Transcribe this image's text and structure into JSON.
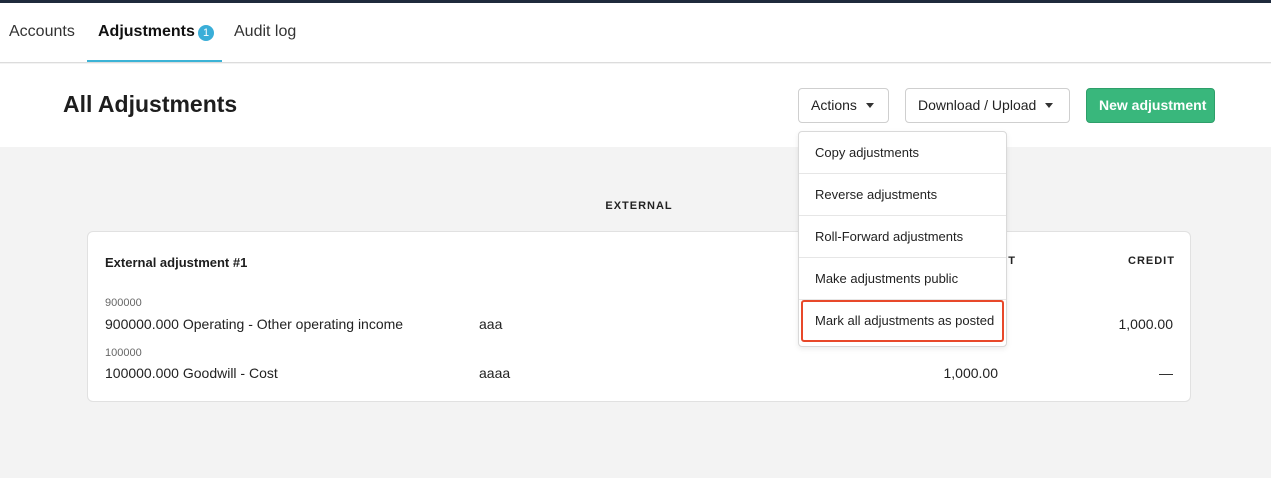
{
  "tabs": {
    "accounts": "Accounts",
    "adjustments": "Adjustments",
    "adjustments_badge": "1",
    "audit_log": "Audit log"
  },
  "header": {
    "title": "All Adjustments",
    "actions_label": "Actions",
    "download_upload_label": "Download / Upload",
    "new_adjustment_label": "New adjustment"
  },
  "section": {
    "label": "EXTERNAL"
  },
  "card": {
    "title": "External adjustment #1",
    "debit_header": "DEBIT",
    "credit_header": "CREDIT",
    "rows": [
      {
        "code": "900000",
        "name": "900000.000 Operating - Other operating income",
        "memo": "aaa",
        "debit": "",
        "credit": "1,000.00"
      },
      {
        "code": "100000",
        "name": "100000.000 Goodwill - Cost",
        "memo": "aaaa",
        "debit": "1,000.00",
        "credit": "—"
      }
    ]
  },
  "actions_menu": {
    "items": [
      "Copy adjustments",
      "Reverse adjustments",
      "Roll-Forward adjustments",
      "Make adjustments public",
      "Mark all adjustments as posted"
    ]
  },
  "colors": {
    "accent": "#3aaed8",
    "primary_button": "#39b77c",
    "highlight": "#e8482a"
  }
}
